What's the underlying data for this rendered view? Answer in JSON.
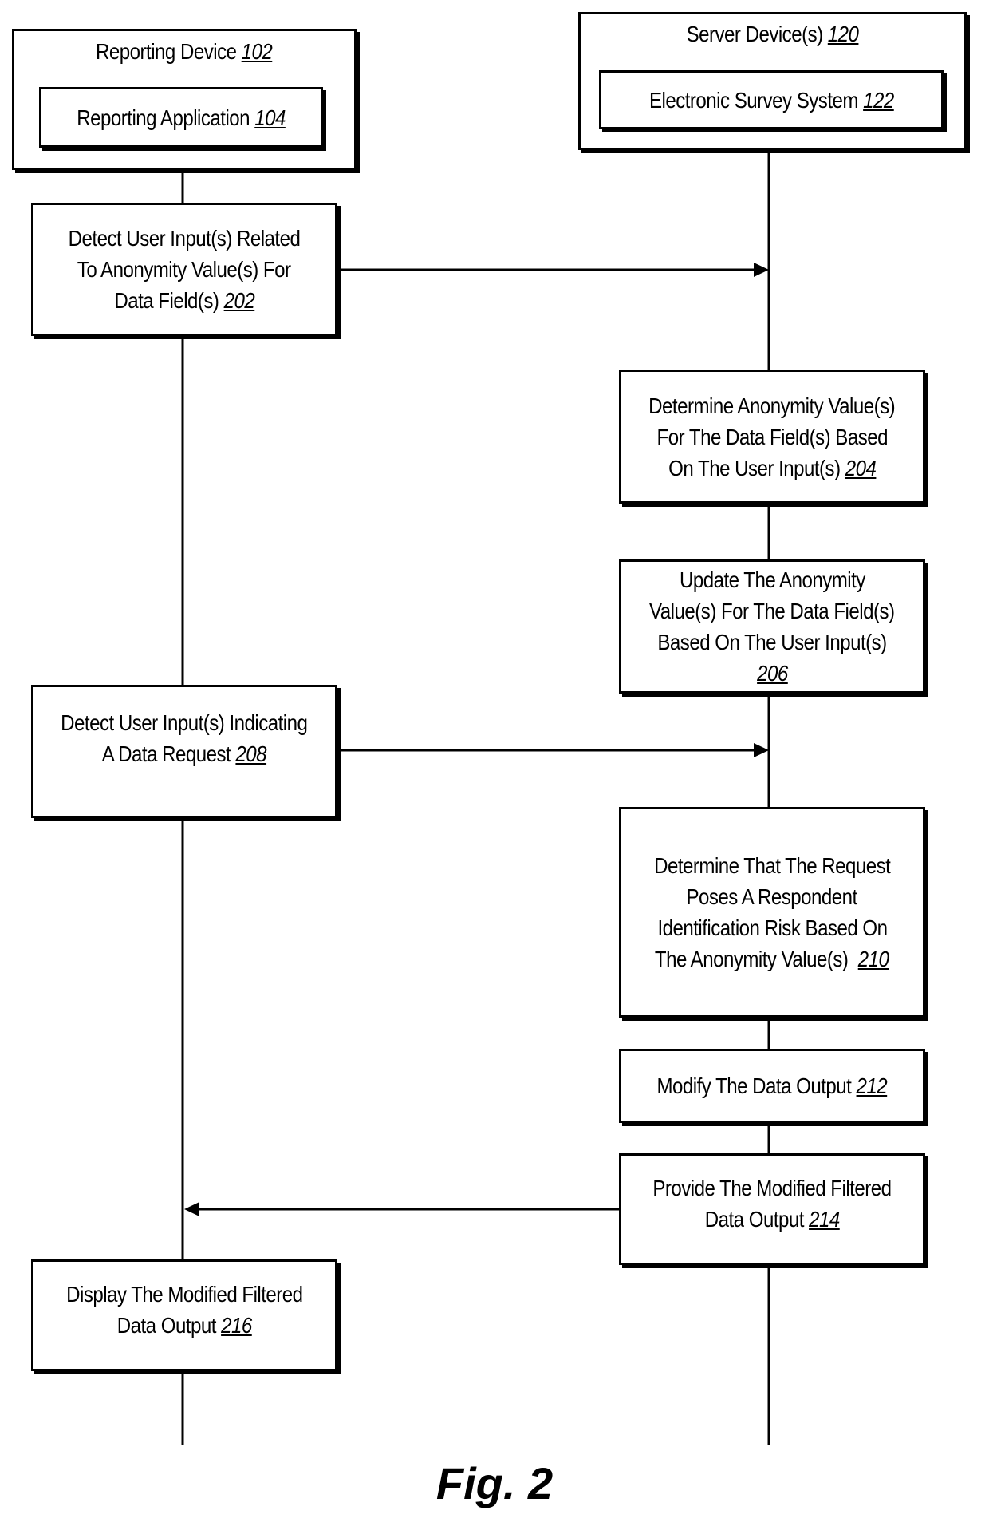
{
  "participants": {
    "reporting_device": {
      "title": "Reporting Device",
      "ref": "102",
      "inner": {
        "title": "Reporting Application",
        "ref": "104"
      }
    },
    "server_device": {
      "title": "Server Device(s)",
      "ref": "120",
      "inner": {
        "title": "Electronic Survey System",
        "ref": "122"
      }
    }
  },
  "steps": {
    "s202": {
      "lines": [
        "Detect User Input(s) Related",
        "To Anonymity Value(s) For",
        "Data Field(s)"
      ],
      "ref": "202",
      "lane": "reporting_device"
    },
    "s204": {
      "lines": [
        "Determine Anonymity Value(s)",
        "For The Data Field(s) Based",
        "On The User Input(s)"
      ],
      "ref": "204",
      "lane": "server_device"
    },
    "s206": {
      "lines": [
        "Update The Anonymity",
        "Value(s) For The Data Field(s)",
        "Based On The User Input(s)"
      ],
      "ref": "206",
      "lane": "server_device"
    },
    "s208": {
      "lines": [
        "Detect User Input(s) Indicating",
        "A Data Request"
      ],
      "ref": "208",
      "lane": "reporting_device"
    },
    "s210": {
      "lines": [
        "Determine That The Request",
        "Poses A Respondent",
        "Identification Risk Based On",
        "The Anonymity Value(s)"
      ],
      "ref": "210",
      "lane": "server_device"
    },
    "s212": {
      "lines": [
        "Modify The Data Output"
      ],
      "ref": "212",
      "lane": "server_device"
    },
    "s214": {
      "lines": [
        "Provide The Modified Filtered",
        "Data Output"
      ],
      "ref": "214",
      "lane": "server_device"
    },
    "s216": {
      "lines": [
        "Display The Modified Filtered",
        "Data Output"
      ],
      "ref": "216",
      "lane": "reporting_device"
    }
  },
  "messages": [
    {
      "from": "202",
      "to": "server_device",
      "direction": "right"
    },
    {
      "from": "208",
      "to": "server_device",
      "direction": "right"
    },
    {
      "from": "214",
      "to": "reporting_device",
      "direction": "left"
    }
  ],
  "figure_label": "Fig. 2"
}
